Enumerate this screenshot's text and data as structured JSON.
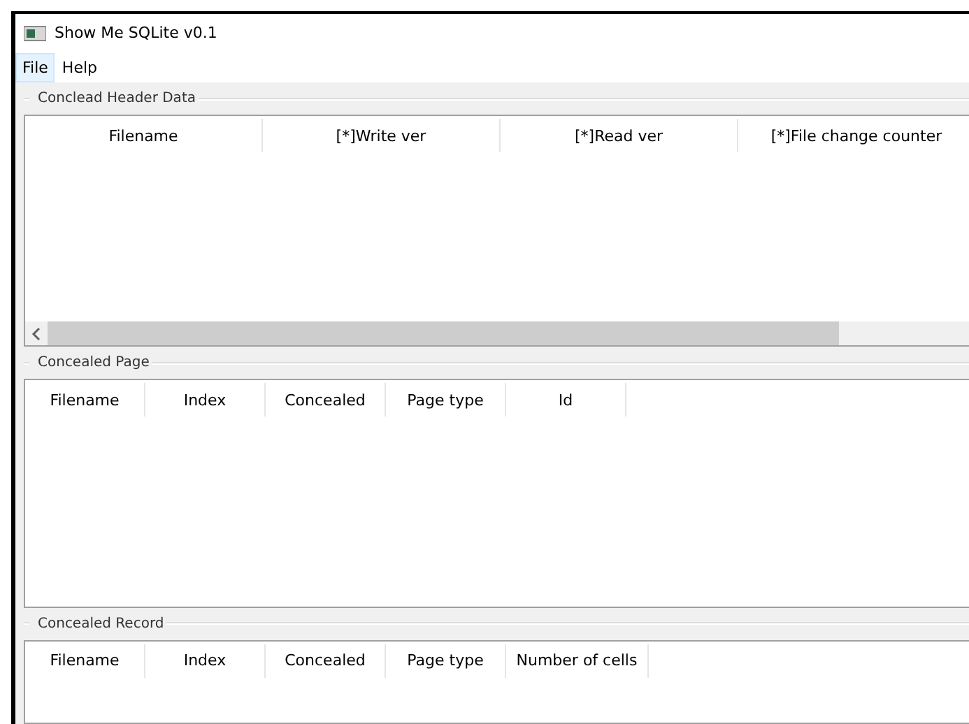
{
  "window": {
    "title": "Show Me SQLite v0.1"
  },
  "menu": [
    {
      "label": "File",
      "selected": true
    },
    {
      "label": "Help",
      "selected": false
    }
  ],
  "groups": [
    {
      "title": "Conclead Header Data",
      "columns": [
        "Filename",
        "[*]Write ver",
        "[*]Read ver",
        "[*]File change counter"
      ]
    },
    {
      "title": "Concealed Page",
      "columns": [
        "Filename",
        "Index",
        "Concealed",
        "Page type",
        "Id"
      ]
    },
    {
      "title": "Concealed Record",
      "columns": [
        "Filename",
        "Index",
        "Concealed",
        "Page type",
        "Number of cells"
      ]
    }
  ]
}
